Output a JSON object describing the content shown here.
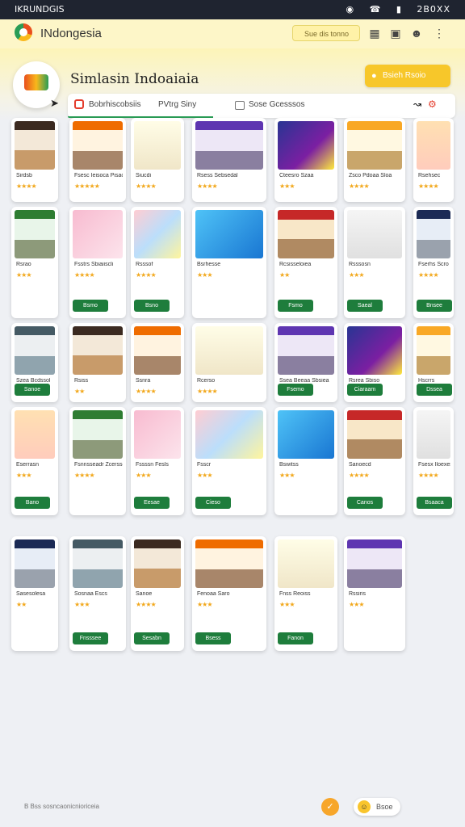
{
  "status_bar": {
    "left_text": "IKRUNDGIS",
    "right_text": "2B0XX",
    "icons": [
      "wifi-icon",
      "phone-icon",
      "signal-icon"
    ]
  },
  "header": {
    "app_title": "INdongesia",
    "search_placeholder": "Sue dis tonno",
    "icons": [
      "calendar-icon",
      "cart-icon",
      "user-icon",
      "menu-icon"
    ]
  },
  "page": {
    "title": "Simlasin Indoaiaia",
    "cta_label": "Bsieh Rsoio"
  },
  "toolbar": {
    "item1": "Bobrhiscobsiis",
    "item2": "PVtrg Siny",
    "item3": "Sose Gcesssos",
    "icons": [
      "graph-icon",
      "settings-icon"
    ]
  },
  "cards": [
    {
      "title": "Sirdsb",
      "rating": "★★★★",
      "button": ""
    },
    {
      "title": "Fsesc Ieisoca Pisao",
      "rating": "★★★★★",
      "button": ""
    },
    {
      "title": "Siucdi",
      "rating": "★★★★",
      "button": ""
    },
    {
      "title": "Rsess Sebsedal",
      "rating": "★★★★",
      "button": ""
    },
    {
      "title": "Cteesro Szaa",
      "rating": "★★★",
      "button": ""
    },
    {
      "title": "Zsco Pdoaa Sloa",
      "rating": "★★★★",
      "button": ""
    },
    {
      "title": "Rsehsec",
      "rating": "★★★★",
      "button": ""
    },
    {
      "title": "Rsrao",
      "rating": "★★★",
      "button": ""
    },
    {
      "title": "Fsstrs Sbiaiiscli",
      "rating": "★★★★",
      "button": "Bsmo"
    },
    {
      "title": "Rsssof",
      "rating": "★★★★",
      "button": "Bsno"
    },
    {
      "title": "Bsrhesse",
      "rating": "★★★",
      "button": ""
    },
    {
      "title": "Rcsisseloiea",
      "rating": "★★",
      "button": "Fsmo"
    },
    {
      "title": "Rsssosn",
      "rating": "★★★",
      "button": "Saeal"
    },
    {
      "title": "Fserhs Scro",
      "rating": "★★★★",
      "button": "Bnsee"
    },
    {
      "title": "Szea Bcdssol",
      "rating": "★★★★",
      "button": "Sanoe"
    },
    {
      "title": "Rsiss",
      "rating": "★★",
      "button": ""
    },
    {
      "title": "Ssnra",
      "rating": "★★★★",
      "button": ""
    },
    {
      "title": "Rcerso",
      "rating": "★★★★",
      "button": ""
    },
    {
      "title": "Ssea Beeaa Sbsiea",
      "rating": "★★★",
      "button": "Fsemo"
    },
    {
      "title": "Rsrea Sbiso",
      "rating": "★★★★",
      "button": "Ciaraam"
    },
    {
      "title": "Hscrrs",
      "rating": "★★★★",
      "button": "Dssea"
    },
    {
      "title": "Eserrasn",
      "rating": "★★★",
      "button": "Bano"
    },
    {
      "title": "Fsnnsseadr Zcerssed",
      "rating": "★★★★",
      "button": ""
    },
    {
      "title": "Fssssn Fesls",
      "rating": "★★★",
      "button": "Eesae"
    },
    {
      "title": "Fsscr",
      "rating": "★★★",
      "button": "Cieso"
    },
    {
      "title": "Bswitss",
      "rating": "★★★",
      "button": ""
    },
    {
      "title": "Sanoecd",
      "rating": "★★★★",
      "button": "Canos"
    },
    {
      "title": "Fsesx Iloexesdx",
      "rating": "★★★★",
      "button": "Bsaaca"
    },
    {
      "title": "Sasesolesa",
      "rating": "★★",
      "button": ""
    },
    {
      "title": "Sosnaa Escs",
      "rating": "★★★",
      "button": "Fnsssee"
    },
    {
      "title": "Sanoe",
      "rating": "★★★★",
      "button": "Sesabn"
    },
    {
      "title": "Fenoaa Saro",
      "rating": "★★★",
      "button": "Bsess"
    },
    {
      "title": "Fnss Reoiss",
      "rating": "★★★",
      "button": "Fanon"
    },
    {
      "title": "Rssiris",
      "rating": "★★★",
      "button": ""
    }
  ],
  "footer": {
    "note": "B Bss sosncaonicnioriceia",
    "action_label": "Bsoe"
  }
}
